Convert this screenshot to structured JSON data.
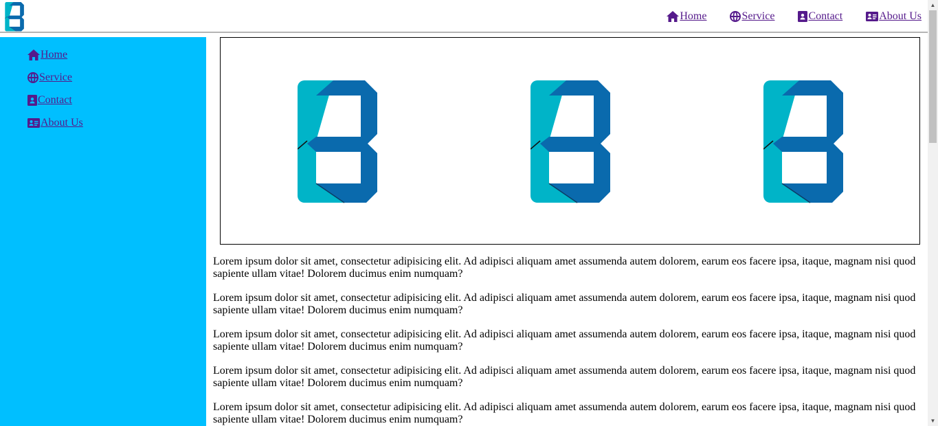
{
  "header": {
    "logo_icon": "brand-b-logo",
    "nav": [
      {
        "label": "Home",
        "icon": "home-icon"
      },
      {
        "label": "Service",
        "icon": "globe-icon"
      },
      {
        "label": "Contact",
        "icon": "contact-card-icon"
      },
      {
        "label": "About Us",
        "icon": "id-card-icon"
      }
    ]
  },
  "sidebar": {
    "background": "#00bfff",
    "nav": [
      {
        "label": "Home",
        "icon": "home-icon"
      },
      {
        "label": "Service",
        "icon": "globe-icon"
      },
      {
        "label": "Contact",
        "icon": "contact-card-icon"
      },
      {
        "label": "About Us",
        "icon": "id-card-icon"
      }
    ]
  },
  "banner": {
    "images": [
      "brand-b-logo",
      "brand-b-logo",
      "brand-b-logo"
    ]
  },
  "main": {
    "paragraphs": [
      "Lorem ipsum dolor sit amet, consectetur adipisicing elit. Ad adipisci aliquam amet assumenda autem dolorem, earum eos facere ipsa, itaque, magnam nisi quod sapiente ullam vitae! Dolorem ducimus enim numquam?",
      "Lorem ipsum dolor sit amet, consectetur adipisicing elit. Ad adipisci aliquam amet assumenda autem dolorem, earum eos facere ipsa, itaque, magnam nisi quod sapiente ullam vitae! Dolorem ducimus enim numquam?",
      "Lorem ipsum dolor sit amet, consectetur adipisicing elit. Ad adipisci aliquam amet assumenda autem dolorem, earum eos facere ipsa, itaque, magnam nisi quod sapiente ullam vitae! Dolorem ducimus enim numquam?",
      "Lorem ipsum dolor sit amet, consectetur adipisicing elit. Ad adipisci aliquam amet assumenda autem dolorem, earum eos facere ipsa, itaque, magnam nisi quod sapiente ullam vitae! Dolorem ducimus enim numquam?",
      "Lorem ipsum dolor sit amet, consectetur adipisicing elit. Ad adipisci aliquam amet assumenda autem dolorem, earum eos facere ipsa, itaque, magnam nisi quod sapiente ullam vitae! Dolorem ducimus enim numquam?"
    ]
  },
  "colors": {
    "link": "#551a8b",
    "logo_light": "#00b4c8",
    "logo_dark": "#0a6aad"
  }
}
